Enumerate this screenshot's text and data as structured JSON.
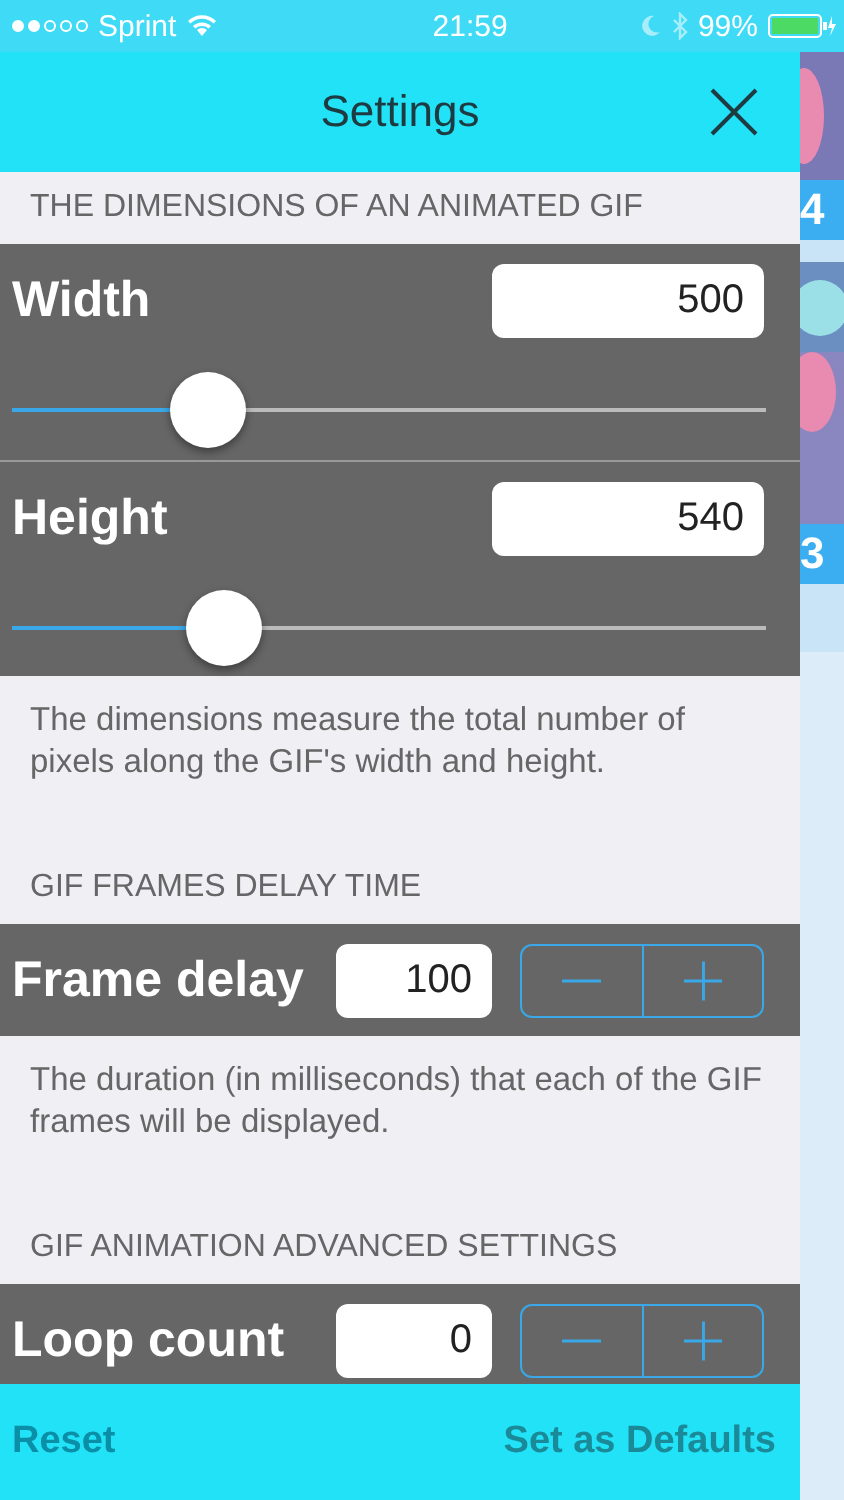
{
  "status_bar": {
    "carrier": "Sprint",
    "time": "21:59",
    "battery": "99%"
  },
  "nav": {
    "title": "Settings"
  },
  "sections": [
    {
      "header": "THE DIMENSIONS OF AN ANIMATED GIF",
      "rows": [
        {
          "kind": "slider",
          "label": "Width",
          "value": "500",
          "level": 0.26
        },
        {
          "kind": "slider",
          "label": "Height",
          "value": "540",
          "level": 0.28
        }
      ],
      "footer": "The dimensions measure the total number of pixels along the GIF's width and height."
    },
    {
      "header": "GIF FRAMES DELAY TIME",
      "rows": [
        {
          "kind": "stepper",
          "label": "Frame delay",
          "value": "100"
        }
      ],
      "footer": "The duration (in milliseconds) that each of the GIF frames will be displayed."
    },
    {
      "header": "GIF ANIMATION ADVANCED SETTINGS",
      "rows": [
        {
          "kind": "stepper",
          "label": "Loop count",
          "value": "0"
        }
      ]
    }
  ],
  "background_labels": [
    "4",
    "3"
  ],
  "bottom_bar": {
    "left": "Reset",
    "right": "Set as Defaults"
  }
}
